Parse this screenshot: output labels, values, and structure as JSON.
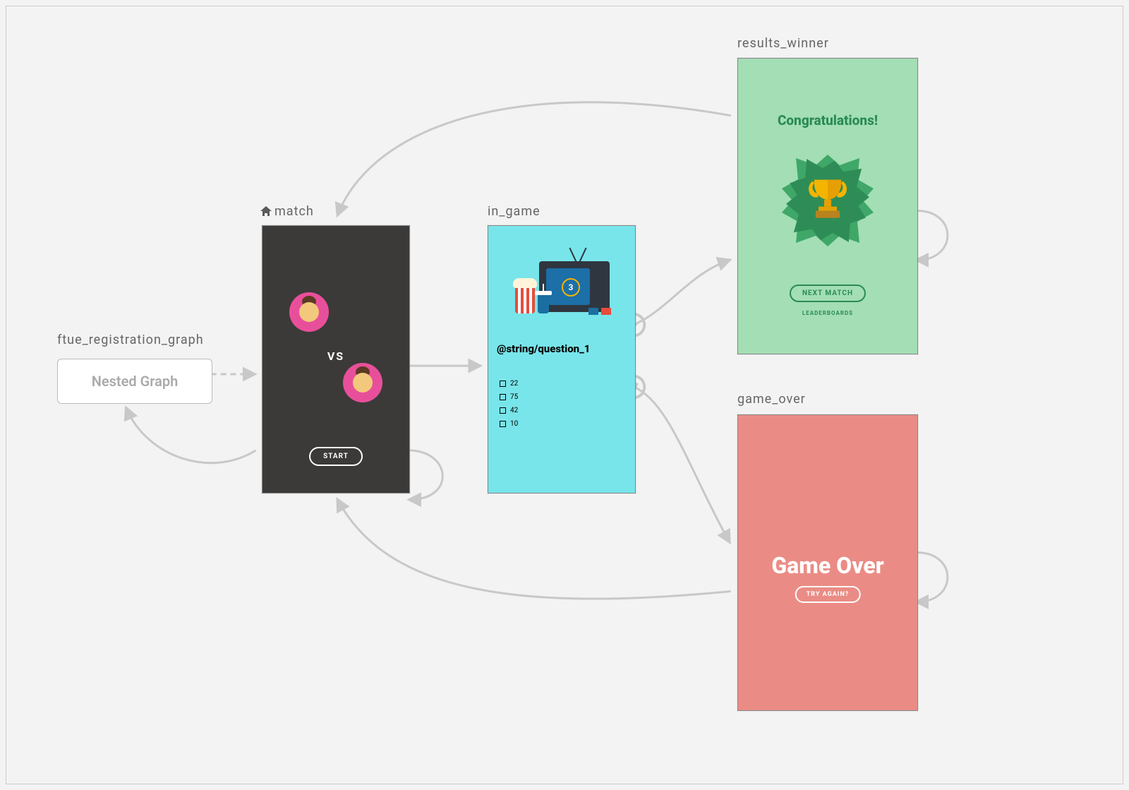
{
  "nodes": {
    "ftue_registration": {
      "label": "ftue_registration_graph",
      "box_label": "Nested Graph"
    },
    "match": {
      "label": "match",
      "vs": "VS",
      "start": "START"
    },
    "in_game": {
      "label": "in_game",
      "countdown": "3",
      "question": "@string/question_1",
      "answers": [
        "22",
        "75",
        "42",
        "10"
      ]
    },
    "results_winner": {
      "label": "results_winner",
      "title": "Congratulations!",
      "next_button": "NEXT MATCH",
      "leaderboards": "LEADERBOARDS"
    },
    "game_over": {
      "label": "game_over",
      "title": "Game Over",
      "button": "TRY AGAIN?"
    }
  },
  "colors": {
    "match_bg": "#3b3a38",
    "in_game_bg": "#78e5ea",
    "winner_bg": "#a3deb4",
    "winner_accent": "#2a8a55",
    "game_over_bg": "#ea8c85",
    "arrow": "#c8c8c8"
  }
}
